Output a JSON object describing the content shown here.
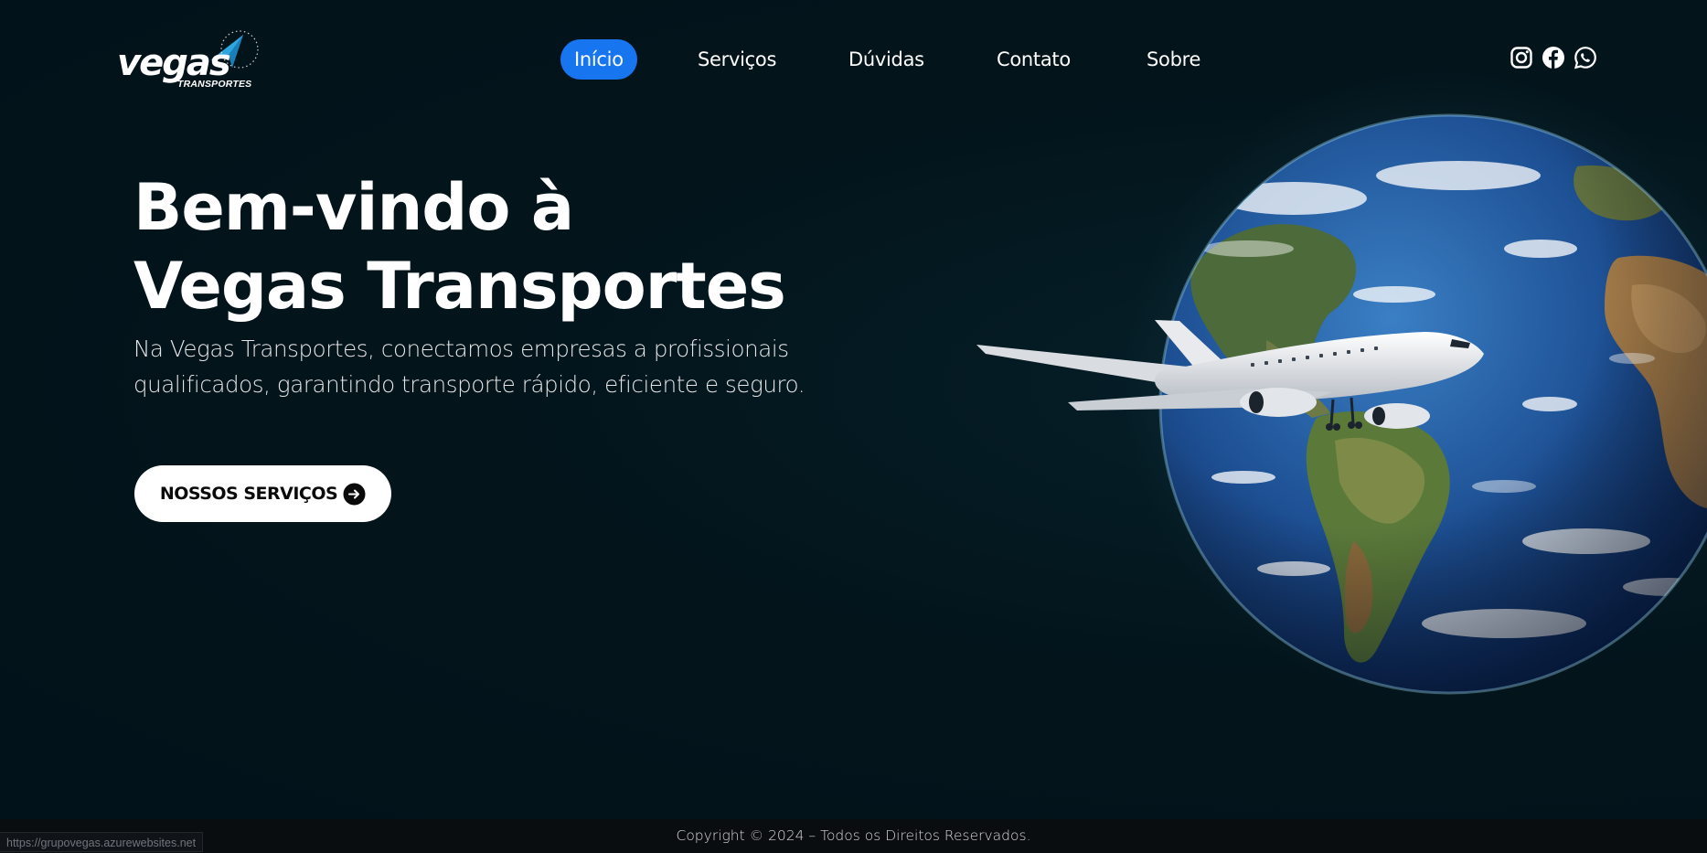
{
  "logo": {
    "word": "vegas",
    "sub": "TRANSPORTES"
  },
  "nav": {
    "items": [
      {
        "label": "Início",
        "active": true
      },
      {
        "label": "Serviços",
        "active": false
      },
      {
        "label": "Dúvidas",
        "active": false
      },
      {
        "label": "Contato",
        "active": false
      },
      {
        "label": "Sobre",
        "active": false
      }
    ],
    "active_color": "#1775f0"
  },
  "social": {
    "icons": [
      "instagram-icon",
      "facebook-icon",
      "whatsapp-icon"
    ]
  },
  "hero": {
    "title_line1": "Bem-vindo à",
    "title_line2": "Vegas Transportes",
    "description": "Na Vegas Transportes, conectamos empresas a profissionais qualificados, garantindo transporte rápido, eficiente e seguro.",
    "cta_label": "NOSSOS SERVIÇOS",
    "cta_icon": "arrow-right-circle-icon"
  },
  "footer": {
    "copyright": "Copyright © 2024 – Todos os Direitos Reservados."
  },
  "status_bar": {
    "url": "https://grupovegas.azurewebsites.net"
  },
  "colors": {
    "background": "#02131a",
    "accent": "#1775f0",
    "cta_background": "#ffffff"
  }
}
